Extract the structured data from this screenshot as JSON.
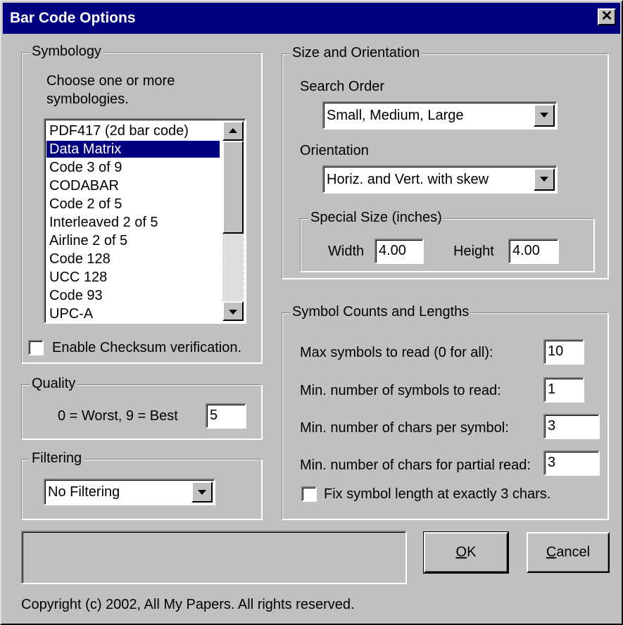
{
  "window": {
    "title": "Bar Code Options",
    "close_glyph": "✕"
  },
  "symbology": {
    "label": "Symbology",
    "instructions_line1": "Choose one or more",
    "instructions_line2": "symbologies.",
    "items": [
      "PDF417 (2d bar code)",
      "Data Matrix",
      "Code 3 of 9",
      "CODABAR",
      "Code 2 of 5",
      "Interleaved 2 of 5",
      "Airline 2 of 5",
      "Code 128",
      "UCC 128",
      "Code 93",
      "UPC-A"
    ],
    "selected": "Data Matrix",
    "checksum_label": "Enable Checksum verification.",
    "checksum_checked": false
  },
  "quality": {
    "label": "Quality",
    "scale_text": "0 = Worst, 9 = Best",
    "value": "5"
  },
  "filtering": {
    "label": "Filtering",
    "value": "No Filtering"
  },
  "size": {
    "label": "Size and Orientation",
    "search_order_label": "Search Order",
    "search_order_value": "Small, Medium, Large",
    "orientation_label": "Orientation",
    "orientation_value": "Horiz. and Vert. with skew",
    "special_label": "Special Size (inches)",
    "width_label": "Width",
    "width_value": "4.00",
    "height_label": "Height",
    "height_value": "4.00"
  },
  "counts": {
    "label": "Symbol Counts and Lengths",
    "max_label": "Max symbols to read (0 for all):",
    "max_value": "10",
    "min_symbols_label": "Min. number of symbols to read:",
    "min_symbols_value": "1",
    "min_chars_label": "Min. number of chars per symbol:",
    "min_chars_value": "3",
    "partial_label": "Min. number of chars for partial read:",
    "partial_value": "3",
    "fix_label": "Fix symbol length at exactly 3 chars.",
    "fix_checked": false
  },
  "status": {
    "text": ""
  },
  "buttons": {
    "ok_u": "O",
    "ok_rest": "K",
    "cancel_u": "C",
    "cancel_rest": "ancel"
  },
  "footer": {
    "copyright": "Copyright (c) 2002, All My Papers.  All rights reserved."
  }
}
